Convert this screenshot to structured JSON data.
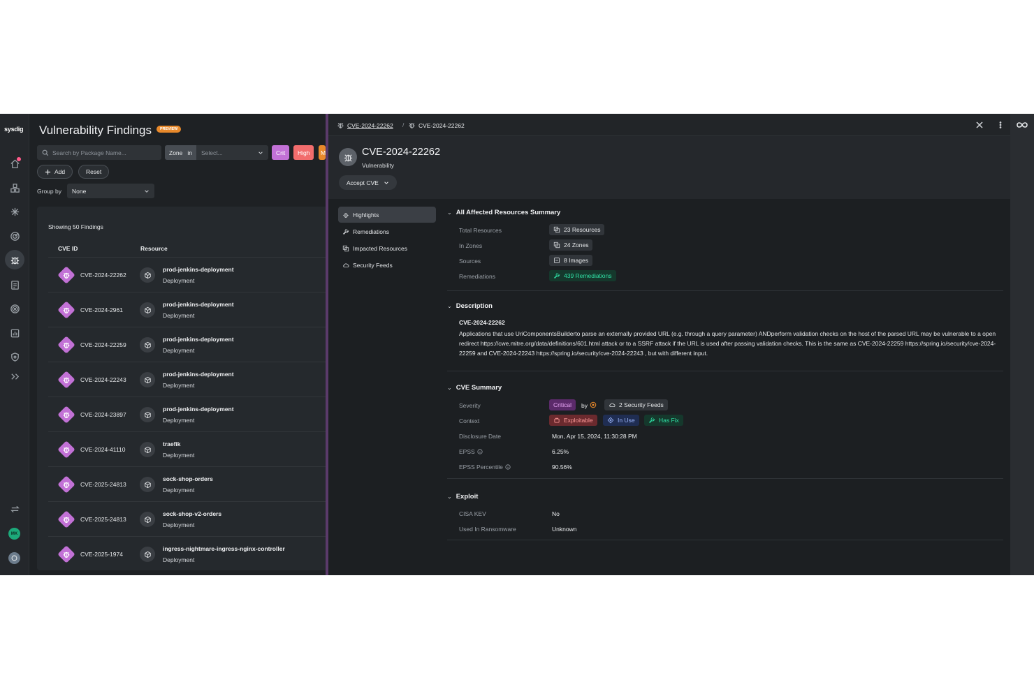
{
  "app": {
    "logo": "sysdig"
  },
  "findings": {
    "title": "Vulnerability Findings",
    "badge": "PREVIEW",
    "search_placeholder": "Search by Package Name...",
    "zone_label": "Zone",
    "zone_op": "in",
    "zone_placeholder": "Select...",
    "severity_chips": [
      "Crit",
      "High",
      "M"
    ],
    "add_label": "Add",
    "reset_label": "Reset",
    "groupby_label": "Group by",
    "groupby_value": "None",
    "showing": "Showing 50 Findings",
    "columns": {
      "cve": "CVE ID",
      "resource": "Resource"
    },
    "rows": [
      {
        "cve": "CVE-2024-22262",
        "resource": "prod-jenkins-deployment",
        "type": "Deployment"
      },
      {
        "cve": "CVE-2024-2961",
        "resource": "prod-jenkins-deployment",
        "type": "Deployment"
      },
      {
        "cve": "CVE-2024-22259",
        "resource": "prod-jenkins-deployment",
        "type": "Deployment"
      },
      {
        "cve": "CVE-2024-22243",
        "resource": "prod-jenkins-deployment",
        "type": "Deployment"
      },
      {
        "cve": "CVE-2024-23897",
        "resource": "prod-jenkins-deployment",
        "type": "Deployment"
      },
      {
        "cve": "CVE-2024-41110",
        "resource": "traefik",
        "type": "Deployment"
      },
      {
        "cve": "CVE-2025-24813",
        "resource": "sock-shop-orders",
        "type": "Deployment"
      },
      {
        "cve": "CVE-2025-24813",
        "resource": "sock-shop-v2-orders",
        "type": "Deployment"
      },
      {
        "cve": "CVE-2025-1974",
        "resource": "ingress-nightmare-ingress-nginx-controller",
        "type": "Deployment"
      }
    ]
  },
  "detail": {
    "breadcrumb": [
      "CVE-2024-22262",
      "CVE-2024-22262"
    ],
    "breadcrumb_sep": "/",
    "title": "CVE-2024-22262",
    "subtitle": "Vulnerability",
    "accept_label": "Accept CVE",
    "menu": [
      "Highlights",
      "Remediations",
      "Impacted Resources",
      "Security Feeds"
    ],
    "summary": {
      "heading": "All Affected Resources Summary",
      "rows": [
        {
          "key": "Total Resources",
          "value": "23 Resources"
        },
        {
          "key": "In Zones",
          "value": "24 Zones"
        },
        {
          "key": "Sources",
          "value": "8 Images"
        },
        {
          "key": "Remediations",
          "value": "439 Remediations"
        }
      ]
    },
    "description": {
      "heading": "Description",
      "title": "CVE-2024-22262",
      "body": "Applications that use UriComponentsBuilderto parse an externally provided URL (e.g. through a query parameter) ANDperform validation checks on the host of the parsed URL may be vulnerable to a open redirect https://cwe.mitre.org/data/definitions/601.html attack or to a SSRF attack if the URL is used after passing validation checks. This is the same as CVE-2024-22259 https://spring.io/security/cve-2024-22259 and CVE-2024-22243 https://spring.io/security/cve-2024-22243 , but with different input."
    },
    "cve_summary": {
      "heading": "CVE Summary",
      "severity_key": "Severity",
      "severity": "Critical",
      "by": "by",
      "feeds": "2 Security Feeds",
      "context_key": "Context",
      "context": [
        "Exploitable",
        "In Use",
        "Has Fix"
      ],
      "disclosure_key": "Disclosure Date",
      "disclosure": "Mon, Apr 15, 2024, 11:30:28 PM",
      "epss_key": "EPSS",
      "epss": "6.25%",
      "epss_pct_key": "EPSS Percentile",
      "epss_pct": "90.56%"
    },
    "exploit": {
      "heading": "Exploit",
      "cisa_key": "CISA KEV",
      "cisa": "No",
      "ransom_key": "Used In Ransomware",
      "ransom": "Unknown"
    }
  },
  "colors": {
    "critical": "#c271d6",
    "high": "#f26d6d",
    "remediation": "#27d29a",
    "exploitable_bg": "#6b2a2e",
    "in_use_bg": "#1f2d52",
    "has_fix_bg": "#15382c"
  },
  "icons": {
    "nav": [
      "home-icon",
      "inventory-icon",
      "integrations-icon",
      "posture-icon",
      "vulnerabilities-icon",
      "policies-icon",
      "threats-icon",
      "reports-icon",
      "shield-icon",
      "expand-icon",
      "sync-icon"
    ],
    "vulnerability": "bug-icon",
    "resource": "cube-icon"
  }
}
